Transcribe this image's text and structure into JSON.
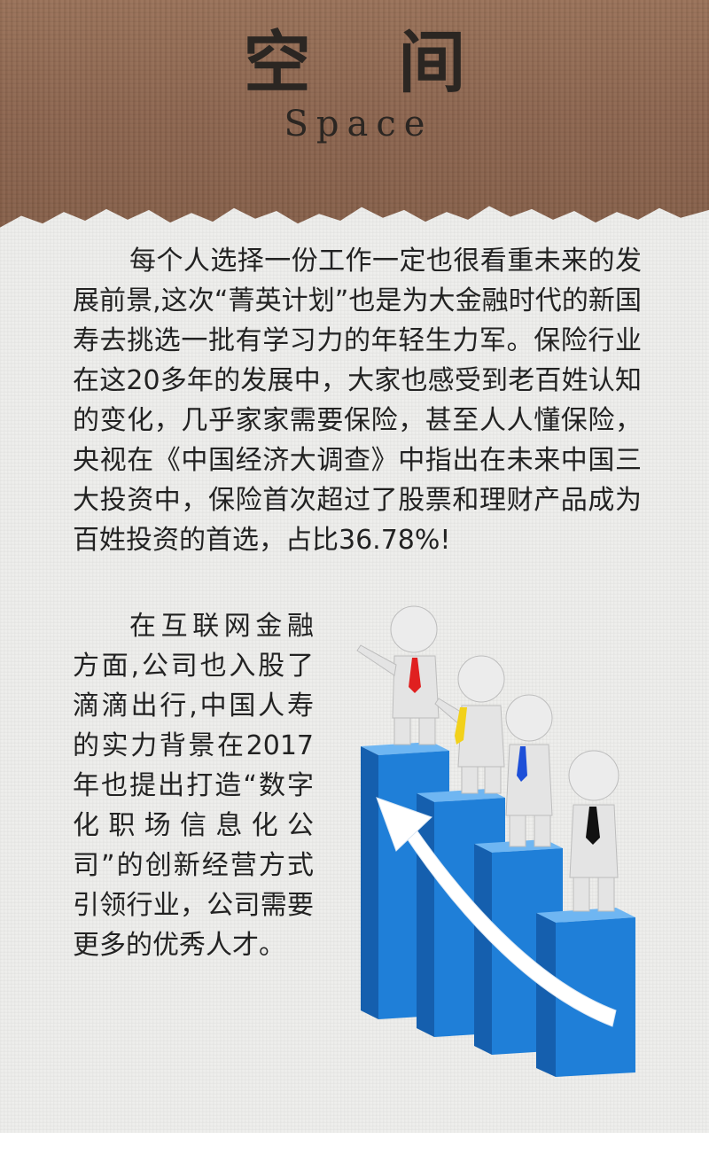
{
  "header": {
    "title_cn": "空 间",
    "title_en": "Space"
  },
  "content": {
    "paragraph_1": "每个人选择一份工作一定也很看重未来的发展前景,这次“菁英计划”也是为大金融时代的新国寿去挑选一批有学习力的年轻生力军。保险行业在这20多年的发展中，大家也感受到老百姓认知的变化，几乎家家需要保险，甚至人人懂保险，央视在《中国经济大调查》中指出在未来中国三大投资中，保险首次超过了股票和理财产品成为百姓投资的首选，占比36.78%!",
    "paragraph_2": "在互联网金融方面,公司也入股了滴滴出行,中国人寿的实力背景在2017年也提出打造“数字化职场信息化公司”的创新经营方式引领行业，公司需要更多的优秀人才。"
  },
  "illustration": {
    "icon": "growth-bars-figures-icon",
    "colors": {
      "bar": "#1f7fd8",
      "bar_side": "#155fae",
      "bar_top": "#6fb6f2",
      "arrow": "#ffffff",
      "tie_red": "#e02020",
      "tie_yellow": "#f2d11a",
      "tie_blue": "#1d4fd8",
      "tie_black": "#111111"
    }
  }
}
